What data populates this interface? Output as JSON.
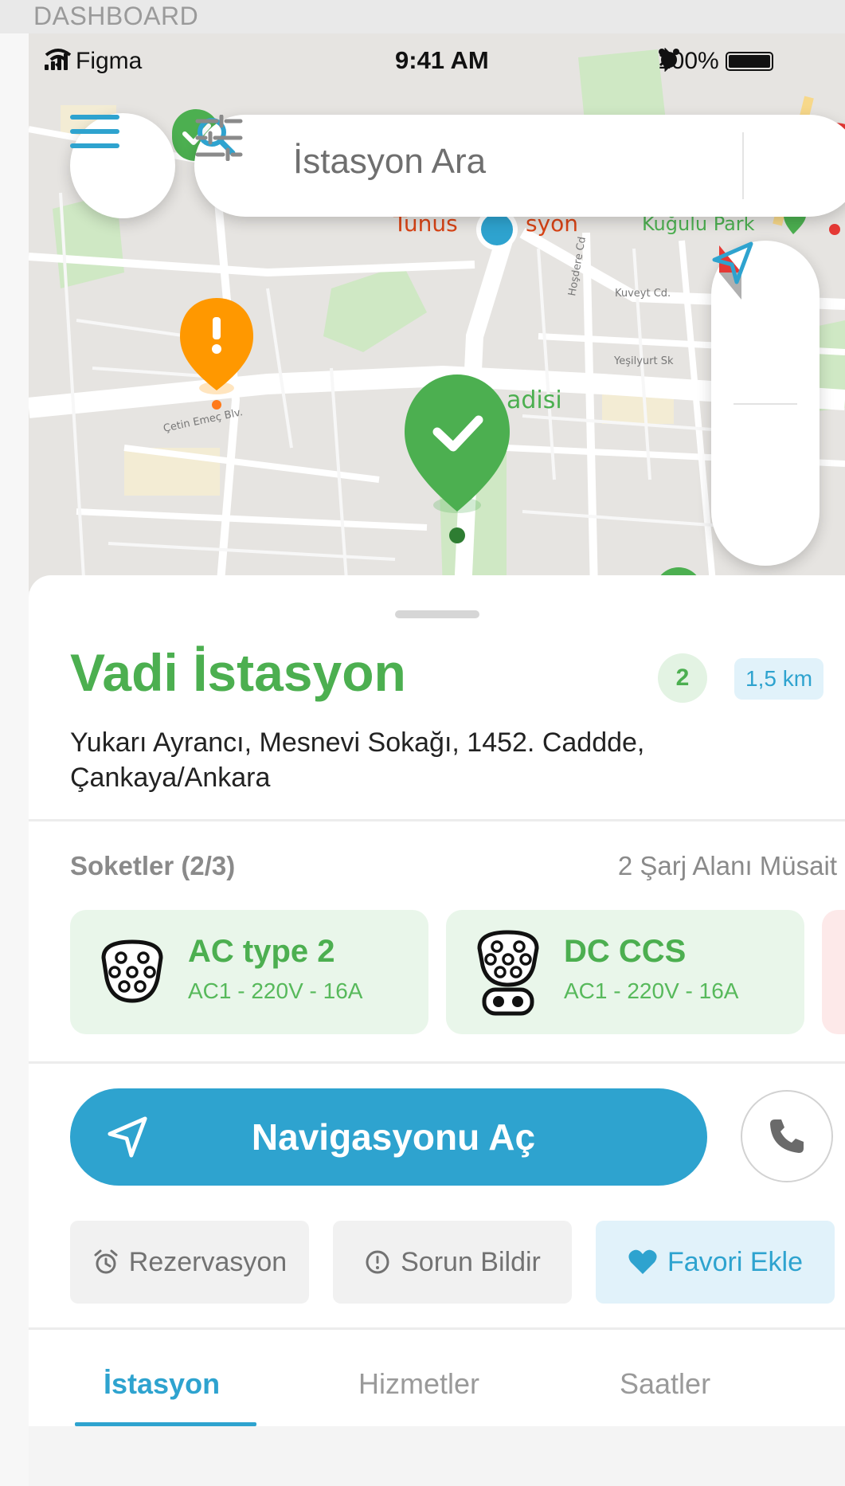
{
  "frame_label": "DASHBOARD",
  "status_bar": {
    "carrier": "Figma",
    "time": "9:41 AM",
    "battery": "100%"
  },
  "map": {
    "street_labels": [
      "Çetin Emeç Blv.",
      "Kuveyt Cd.",
      "Yeşilyurt Sk",
      "Hoşdere Cd",
      "Kuğulu Park",
      "adisi",
      "Tunus",
      "syon"
    ]
  },
  "search": {
    "placeholder": "İstasyon Ara"
  },
  "station": {
    "name": "Vadi İstasyon",
    "available_count": "2",
    "distance": "1,5 km",
    "address": "Yukarı Ayrancı, Mesnevi Sokağı, 1452. Caddde, Çankaya/Ankara"
  },
  "sockets": {
    "title": "Soketler (2/3)",
    "status": "2 Şarj Alanı Müsait",
    "items": [
      {
        "name": "AC type 2",
        "spec": "AC1 - 220V - 16A",
        "icon": "type2-plug-icon"
      },
      {
        "name": "DC CCS",
        "spec": "AC1 - 220V - 16A",
        "icon": "ccs-plug-icon"
      }
    ]
  },
  "actions": {
    "navigate": "Navigasyonu Aç",
    "reservation": "Rezervasyon",
    "report": "Sorun Bildir",
    "favorite": "Favori Ekle"
  },
  "tabs": [
    "İstasyon",
    "Hizmetler",
    "Saatler"
  ],
  "colors": {
    "green": "#4caf50",
    "blue": "#2ea3cf",
    "orange": "#ff9800",
    "red": "#e53935"
  }
}
